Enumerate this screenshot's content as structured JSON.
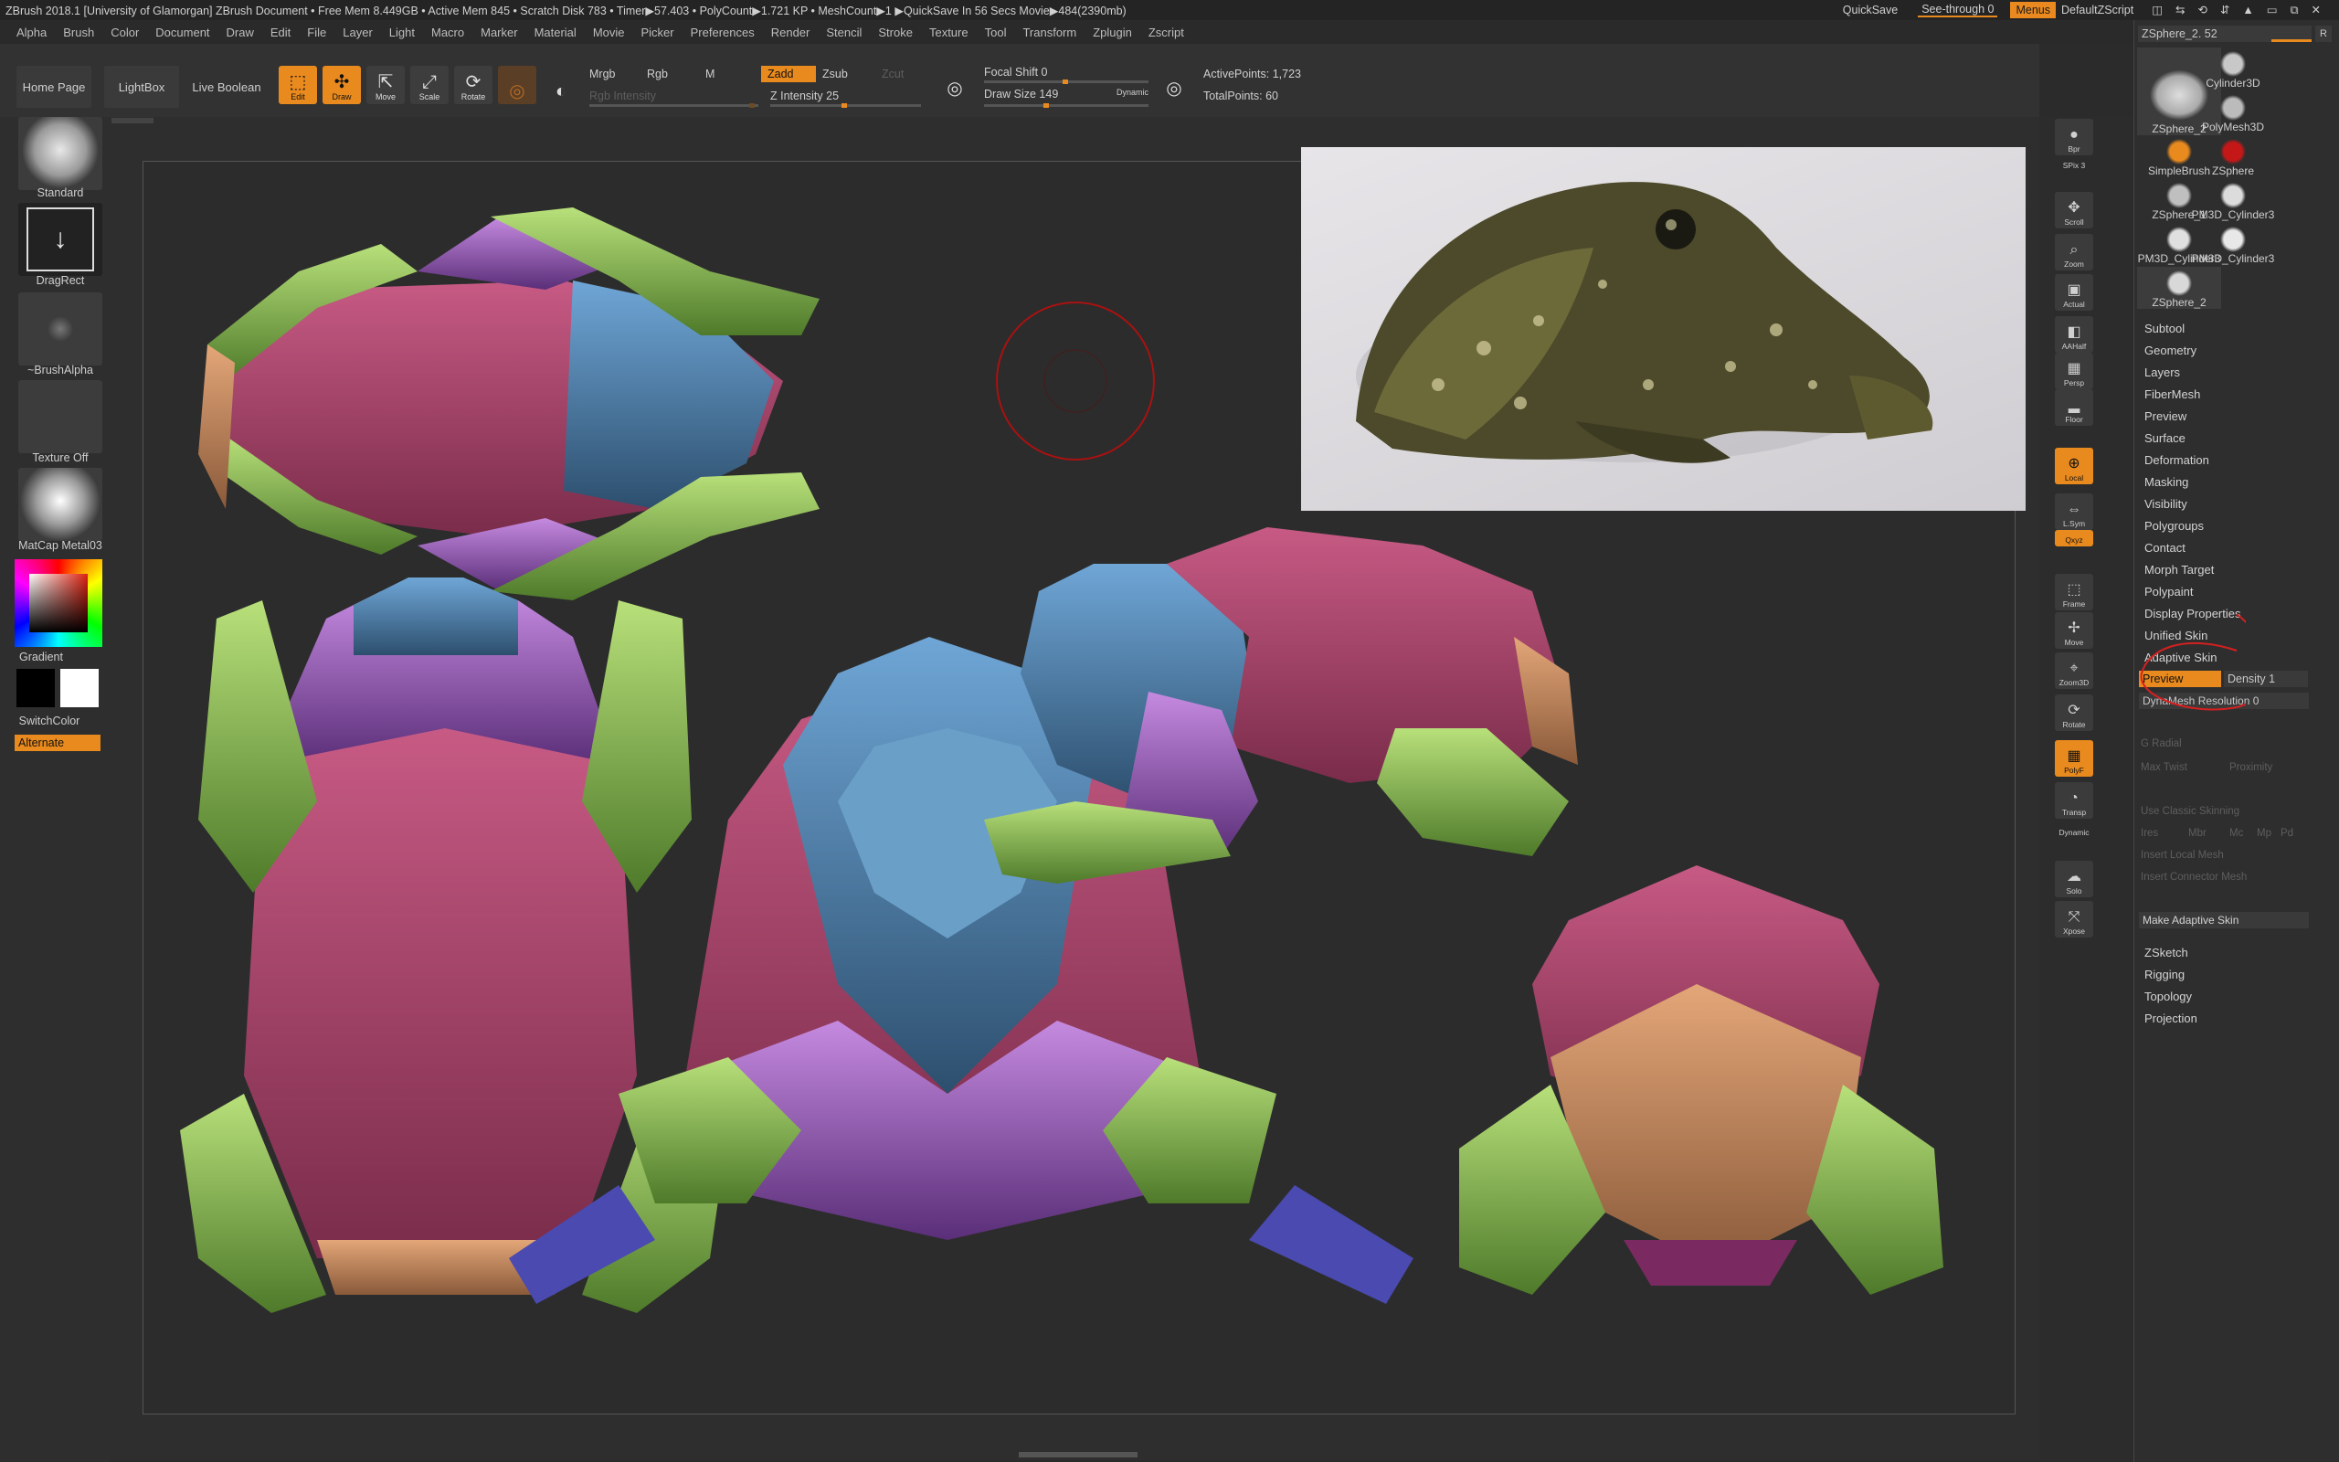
{
  "titlebar": {
    "text": "ZBrush 2018.1 [University of Glamorgan]   ZBrush Document     • Free Mem 8.449GB • Active Mem 845 • Scratch Disk 783 •  Timer▶57.403 • PolyCount▶1.721 KP  • MeshCount▶1  ▶QuickSave In 56 Secs Movie▶484(2390mb)",
    "quicksave": "QuickSave",
    "seethrough": "See-through  0",
    "menus": "Menus",
    "defaultzscript": "DefaultZScript"
  },
  "menubar": [
    "Alpha",
    "Brush",
    "Color",
    "Document",
    "Draw",
    "Edit",
    "File",
    "Layer",
    "Light",
    "Macro",
    "Marker",
    "Material",
    "Movie",
    "Picker",
    "Preferences",
    "Render",
    "Stencil",
    "Stroke",
    "Texture",
    "Tool",
    "Transform",
    "Zplugin",
    "Zscript"
  ],
  "toolbar": {
    "home": "Home Page",
    "lightbox": "LightBox",
    "liveboolean": "Live Boolean",
    "edit": "Edit",
    "draw": "Draw",
    "move": "Move",
    "scale": "Scale",
    "rotate": "Rotate",
    "mrgb": "Mrgb",
    "rgb": "Rgb",
    "m": "M",
    "zadd": "Zadd",
    "zsub": "Zsub",
    "zcut": "Zcut",
    "rgb_intensity": "Rgb Intensity",
    "z_intensity": "Z Intensity 25",
    "focal_shift": "Focal Shift 0",
    "draw_size": "Draw Size 149",
    "dynamic": "Dynamic",
    "active_points": "ActivePoints: 1,723",
    "total_points": "TotalPoints: 60"
  },
  "leftpanel": {
    "standard": "Standard",
    "dragrect": "DragRect",
    "brushalpha": "~BrushAlpha",
    "texture_off": "Texture Off",
    "matcap": "MatCap Metal03",
    "gradient": "Gradient",
    "switchcolor": "SwitchColor",
    "alternate": "Alternate"
  },
  "rightstrip": [
    "Bpr",
    "SPix 3",
    "Scroll",
    "Zoom",
    "Actual",
    "AAHalf",
    "Persp",
    "Floor",
    "Local",
    "L.Sym",
    "Qxyz",
    "Frame",
    "Move",
    "Zoom3D",
    "Rotate",
    "PolyF",
    "Transp",
    "Dynamic",
    "Solo",
    "Xpose"
  ],
  "toolpanel": {
    "header": "ZSphere_2. 52",
    "header_r": "R",
    "thumbs": [
      "ZSphere_2",
      "Cylinder3D",
      "PolyMesh3D",
      "SimpleBrush",
      "ZSphere",
      "ZSphere_1",
      "PM3D_Cylinder3",
      "PM3D_Cylinder3",
      "PM3D_Cylinder3",
      "ZSphere_2"
    ],
    "menus": [
      "Subtool",
      "Geometry",
      "Layers",
      "FiberMesh",
      "Preview",
      "Surface",
      "Deformation",
      "Masking",
      "Visibility",
      "Polygroups",
      "Contact",
      "Morph Target",
      "Polypaint",
      "Display Properties",
      "Unified Skin",
      "Adaptive Skin"
    ],
    "preview_btn": "Preview",
    "density": "Density 1",
    "dynamesh": "DynaMesh Resolution 0",
    "g_radial": "G Radial",
    "max_twist": "Max Twist",
    "proximity": "Proximity",
    "classic": "Use Classic Skinning",
    "ires": "Ires",
    "mbr": "Mbr",
    "mc": "Mc",
    "mp": "Mp",
    "pd": "Pd",
    "insert_local": "Insert Local Mesh",
    "insert_connector": "Insert Connector Mesh",
    "make_adaptive": "Make Adaptive Skin",
    "menus2": [
      "ZSketch",
      "Rigging",
      "Topology",
      "Projection"
    ]
  },
  "colors": {
    "accent": "#e98a1e",
    "bg": "#2b2b2b",
    "red_annotation": "#d42020"
  }
}
